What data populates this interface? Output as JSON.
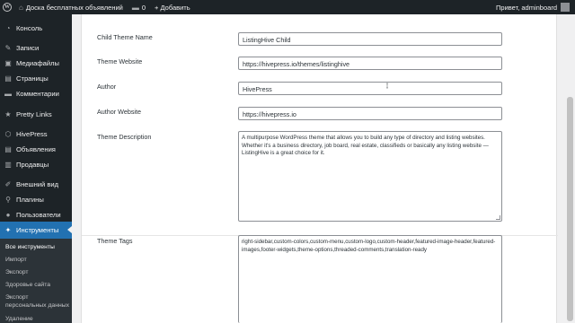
{
  "adminbar": {
    "site_name": "Доска бесплатных объявлений",
    "comments_count": "0",
    "add_new": "+ Добавить",
    "greeting": "Привет, adminboard"
  },
  "sidebar": {
    "items": [
      {
        "label": "Консоль",
        "icon": "dashboard-icon",
        "glyph": "◔"
      },
      {
        "label": "Записи",
        "icon": "pin-icon",
        "glyph": "✎"
      },
      {
        "label": "Медиафайлы",
        "icon": "media-icon",
        "glyph": "▣"
      },
      {
        "label": "Страницы",
        "icon": "page-icon",
        "glyph": "▤"
      },
      {
        "label": "Комментарии",
        "icon": "comment-icon",
        "glyph": "▬"
      },
      {
        "label": "Pretty Links",
        "icon": "star-icon",
        "glyph": "★"
      },
      {
        "label": "HivePress",
        "icon": "hivepress-icon",
        "glyph": "⬡"
      },
      {
        "label": "Объявления",
        "icon": "listing-icon",
        "glyph": "▤"
      },
      {
        "label": "Продавцы",
        "icon": "vendor-icon",
        "glyph": "▥"
      },
      {
        "label": "Внешний вид",
        "icon": "paintbrush-icon",
        "glyph": "✐"
      },
      {
        "label": "Плагины",
        "icon": "plugin-icon",
        "glyph": "⚲"
      },
      {
        "label": "Пользователи",
        "icon": "users-icon",
        "glyph": "●"
      },
      {
        "label": "Инструменты",
        "icon": "tools-icon",
        "glyph": "✦"
      }
    ],
    "submenu": [
      "Все инструменты",
      "Импорт",
      "Экспорт",
      "Здоровье сайта",
      "Экспорт персональных данных",
      "Удаление"
    ]
  },
  "form": {
    "child_theme_name_label": "Child Theme Name",
    "child_theme_name_value": "ListingHive Child",
    "theme_website_label": "Theme Website",
    "theme_website_value": "https://hivepress.io/themes/listinghive",
    "author_label": "Author",
    "author_value": "HivePress",
    "author_website_label": "Author Website",
    "author_website_value": "https://hivepress.io",
    "theme_description_label": "Theme Description",
    "theme_description_value": "A multipurpose WordPress theme that allows you to build any type of directory and listing websites. Whether it's a business directory, job board, real estate, classifieds or basically any listing website — ListingHive is a great choice for it.",
    "theme_tags_label": "Theme Tags",
    "theme_tags_value": "right-sidebar,custom-colors,custom-menu,custom-logo,custom-header,featured-image-header,featured-images,footer-widgets,theme-options,threaded-comments,translation-ready"
  }
}
